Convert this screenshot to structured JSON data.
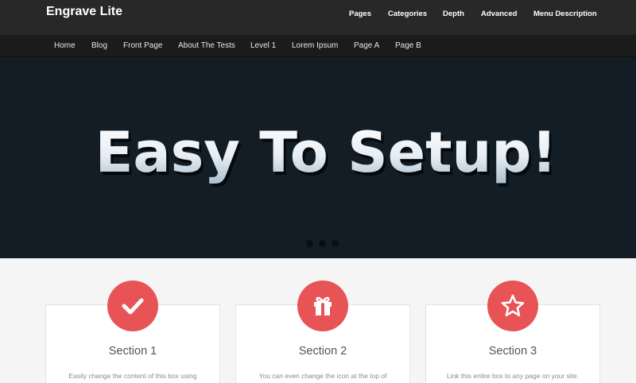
{
  "header": {
    "site_title": "Engrave Lite",
    "top_menu": [
      "Pages",
      "Categories",
      "Depth",
      "Advanced",
      "Menu Description"
    ]
  },
  "subnav": {
    "items": [
      "Home",
      "Blog",
      "Front Page",
      "About The Tests",
      "Level 1",
      "Lorem Ipsum",
      "Page A",
      "Page B"
    ]
  },
  "hero": {
    "headline": "Easy To Setup!",
    "slide_count": 3
  },
  "features": [
    {
      "icon": "checkmark-icon",
      "title": "Section 1",
      "text": "Easily change the content of this box using"
    },
    {
      "icon": "gift-icon",
      "title": "Section 2",
      "text": "You can even change the icon at the top of"
    },
    {
      "icon": "star-icon",
      "title": "Section 3",
      "text": "Link this entire box to any page on your site."
    }
  ],
  "colors": {
    "topbar": "#282828",
    "subnav": "#1b1b1b",
    "hero_bg": "#121d25",
    "accent": "#e85356"
  }
}
